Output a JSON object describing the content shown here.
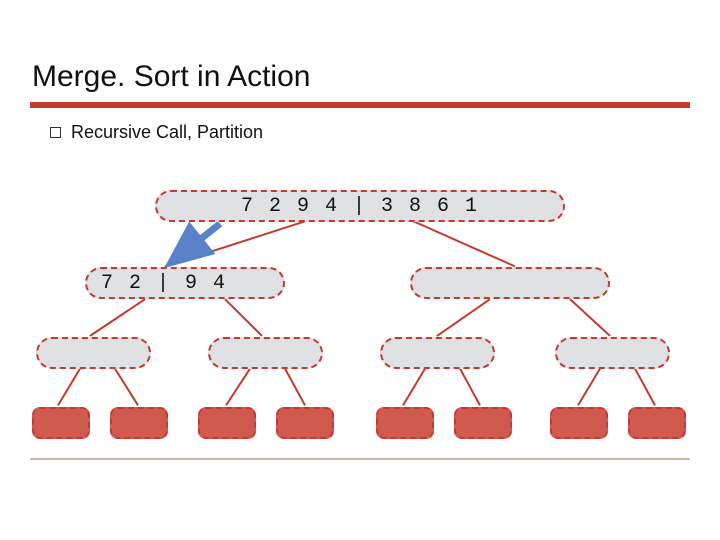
{
  "title": "Merge. Sort in Action",
  "bullet": "Recursive Call, Partition",
  "nodes": {
    "level0": "7 2 9 4 | 3 8 6 1",
    "level1_left": "7 2 | 9 4"
  },
  "colors": {
    "accent": "#c43a2f",
    "node_light": "#e0e1e3",
    "node_red": "#d05a4e"
  }
}
